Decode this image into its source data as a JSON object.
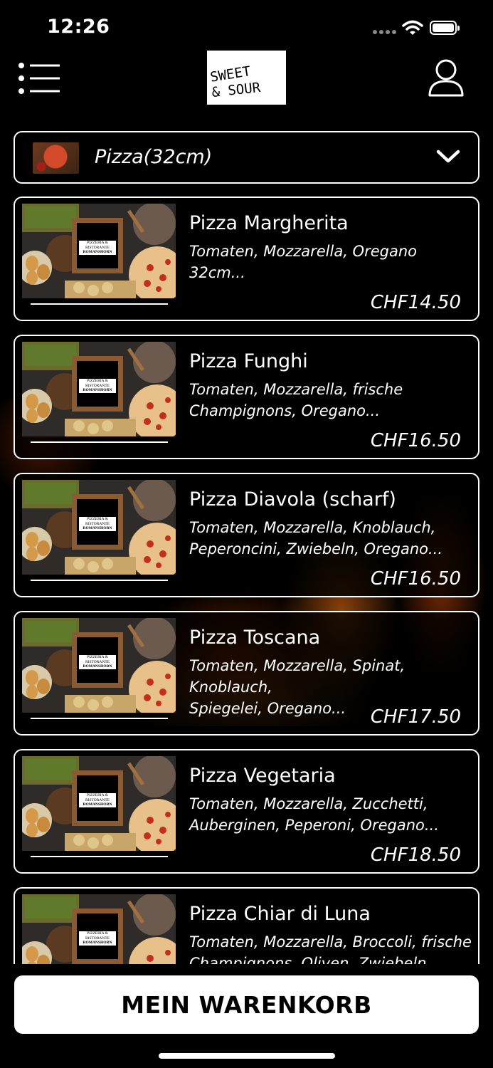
{
  "status_bar": {
    "time": "12:26"
  },
  "header": {
    "logo_text_line1": "SWEET",
    "logo_text_line2": "& SOUR"
  },
  "category": {
    "label": "Pizza(32cm)"
  },
  "product_image_sign": {
    "line1": "PIZZERIA &",
    "line2": "RISTORANTE",
    "line3": "ROMANSHORN"
  },
  "products": [
    {
      "name": "Pizza Margherita",
      "desc_line1": "Tomaten, Mozzarella, Oregano",
      "desc_line2": "32cm...",
      "price": "CHF14.50"
    },
    {
      "name": "Pizza Funghi",
      "desc_line1": "Tomaten, Mozzarella, frische",
      "desc_line2": "Champignons, Oregano...",
      "price": "CHF16.50"
    },
    {
      "name": "Pizza Diavola (scharf)",
      "desc_line1": "Tomaten, Mozzarella, Knoblauch,",
      "desc_line2": "Peperoncini, Zwiebeln, Oregano...",
      "price": "CHF16.50"
    },
    {
      "name": "Pizza Toscana",
      "desc_line1": "Tomaten, Mozzarella, Spinat, Knoblauch,",
      "desc_line2": "Spiegelei, Oregano...",
      "price": "CHF17.50"
    },
    {
      "name": "Pizza Vegetaria",
      "desc_line1": "Tomaten, Mozzarella, Zucchetti,",
      "desc_line2": "Auberginen, Peperoni, Oregano...",
      "price": "CHF18.50"
    },
    {
      "name": "Pizza Chiar di Luna",
      "desc_line1": "Tomaten, Mozzarella, Broccoli, frische",
      "desc_line2": "Champignons, Oliven, Zwiebeln, Orega",
      "price": ""
    }
  ],
  "cart": {
    "label": "MEIN WARENKORB"
  },
  "icons": {
    "menu": "menu-icon",
    "user": "user-icon",
    "chevron": "chevron-down-icon",
    "wifi": "wifi-icon",
    "battery": "battery-icon",
    "signal": "signal-icon"
  },
  "colors": {
    "background": "#000000",
    "foreground": "#ffffff",
    "fire": "#ff7814"
  }
}
